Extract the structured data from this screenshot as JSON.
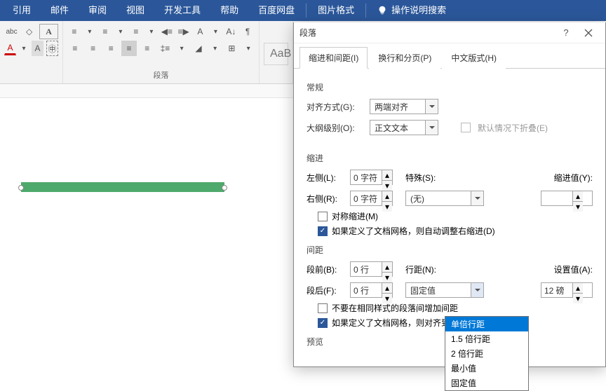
{
  "ribbon": {
    "tabs": [
      "引用",
      "邮件",
      "审阅",
      "视图",
      "开发工具",
      "帮助",
      "百度网盘"
    ],
    "context_tab": "图片格式",
    "tell_me": "操作说明搜索",
    "group_paragraph_label": "段落",
    "styles_placeholder": "AaB"
  },
  "dialog": {
    "title": "段落",
    "help": "?",
    "tabs": {
      "indent_spacing": "缩进和间距(I)",
      "line_page": "换行和分页(P)",
      "chinese": "中文版式(H)"
    },
    "general": {
      "section": "常规",
      "alignment_label": "对齐方式(G):",
      "alignment_value": "两端对齐",
      "outline_label": "大纲级别(O):",
      "outline_value": "正文文本",
      "collapse_label": "默认情况下折叠(E)"
    },
    "indent": {
      "section": "缩进",
      "left_label": "左侧(L):",
      "left_value": "0 字符",
      "right_label": "右侧(R):",
      "right_value": "0 字符",
      "special_label": "特殊(S):",
      "special_value": "(无)",
      "by_label": "缩进值(Y):",
      "by_value": "",
      "mirror_label": "对称缩进(M)",
      "auto_right_label": "如果定义了文档网格，则自动调整右缩进(D)"
    },
    "spacing": {
      "section": "间距",
      "before_label": "段前(B):",
      "before_value": "0 行",
      "after_label": "段后(F):",
      "after_value": "0 行",
      "line_label": "行距(N):",
      "line_value": "固定值",
      "at_label": "设置值(A):",
      "at_value": "12 磅",
      "no_space_label": "不要在相同样式的段落间增加间距",
      "snap_label": "如果定义了文档网格，则对齐到",
      "options": [
        "单倍行距",
        "1.5 倍行距",
        "2 倍行距",
        "最小值",
        "固定值"
      ]
    },
    "preview": {
      "section": "预览"
    }
  }
}
